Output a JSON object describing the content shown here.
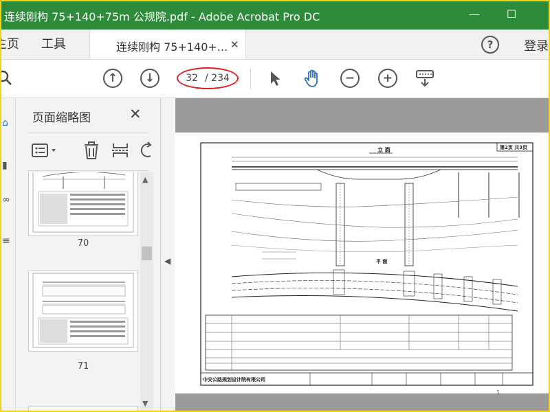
{
  "window": {
    "title": "连续刚构 75+140+75m 公规院.pdf - Adobe Acrobat Pro DC",
    "minimize_icon": "minimize-icon",
    "maximize_icon": "maximize-icon"
  },
  "tabs": {
    "home": "主页",
    "tools": "工具",
    "document": "连续刚构 75+140+...",
    "close_icon": "close-icon",
    "help_icon": "help-icon",
    "login": "登录"
  },
  "toolbar": {
    "page_current": "32",
    "page_total": "/ 234",
    "icons": [
      "search-icon",
      "prev-page-icon",
      "next-page-icon",
      "select-arrow-icon",
      "hand-icon",
      "zoom-out-icon",
      "zoom-in-icon",
      "keyboard-icon"
    ]
  },
  "thumbnail_panel": {
    "title": "页面缩略图",
    "close_icon": "close-icon",
    "tools": [
      "options-icon",
      "delete-icon",
      "insert-icon",
      "rotate-icon"
    ],
    "pages": [
      {
        "number": "70"
      },
      {
        "number": "71"
      }
    ]
  },
  "drawing": {
    "sheet_label": "第2页 共3页",
    "elevation_title": "立 面",
    "plan_title": "平 面",
    "company": "中交公路规划设计院有限公司",
    "page_mark": "1"
  },
  "colors": {
    "titlebar": "#2e8b3a",
    "accent": "#2e6fb8",
    "highlight_ring": "#e02020",
    "document_bg": "#9a9a9a"
  }
}
